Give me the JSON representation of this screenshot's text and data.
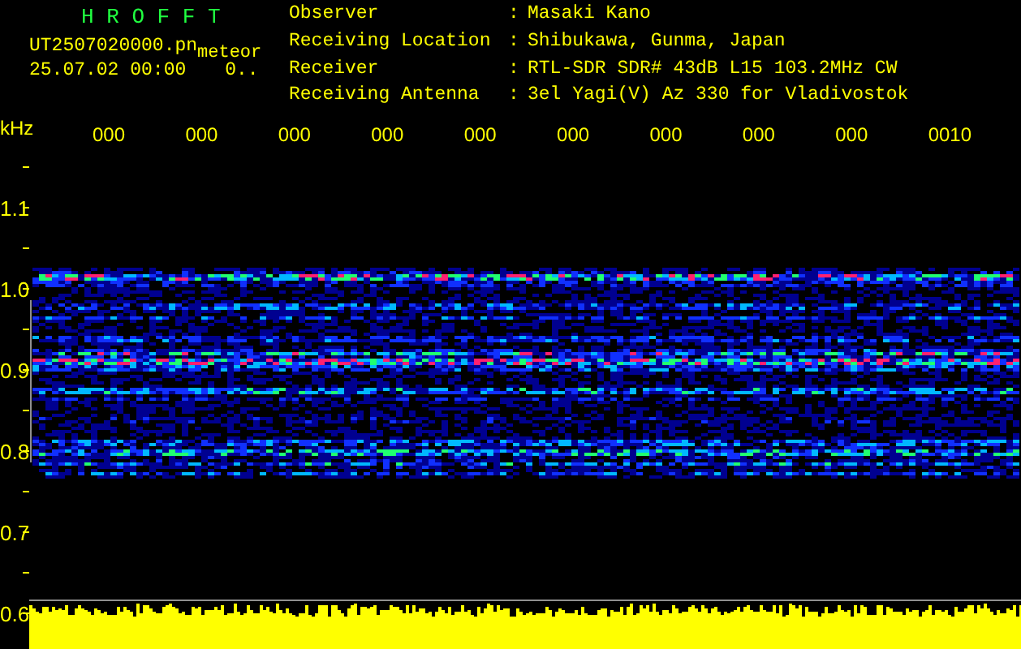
{
  "title": "H R O F F T",
  "file_name": "UT2507020000.pn",
  "mode": "meteor",
  "timestamp": "25.07.02 00:00",
  "counter": "0..",
  "station_info": [
    {
      "label": "Observer",
      "separator": ":",
      "value": "Masaki Kano"
    },
    {
      "label": "Receiving Location",
      "separator": ":",
      "value": "Shibukawa, Gunma, Japan"
    },
    {
      "label": "Receiver",
      "separator": ":",
      "value": "RTL-SDR SDR# 43dB L15 103.2MHz CW"
    },
    {
      "label": "Receiving Antenna",
      "separator": ":",
      "value": "3el Yagi(V) Az 330 for Vladivostok"
    }
  ],
  "time_axis": {
    "unit": "kHz",
    "labels": [
      "000",
      "000",
      "000",
      "000",
      "000",
      "000",
      "000",
      "000",
      "000",
      "0010"
    ]
  },
  "frequency_axis": {
    "labels": [
      "1.1",
      "1.0",
      "0.9",
      "0.8",
      "0.7",
      "0.6"
    ]
  }
}
